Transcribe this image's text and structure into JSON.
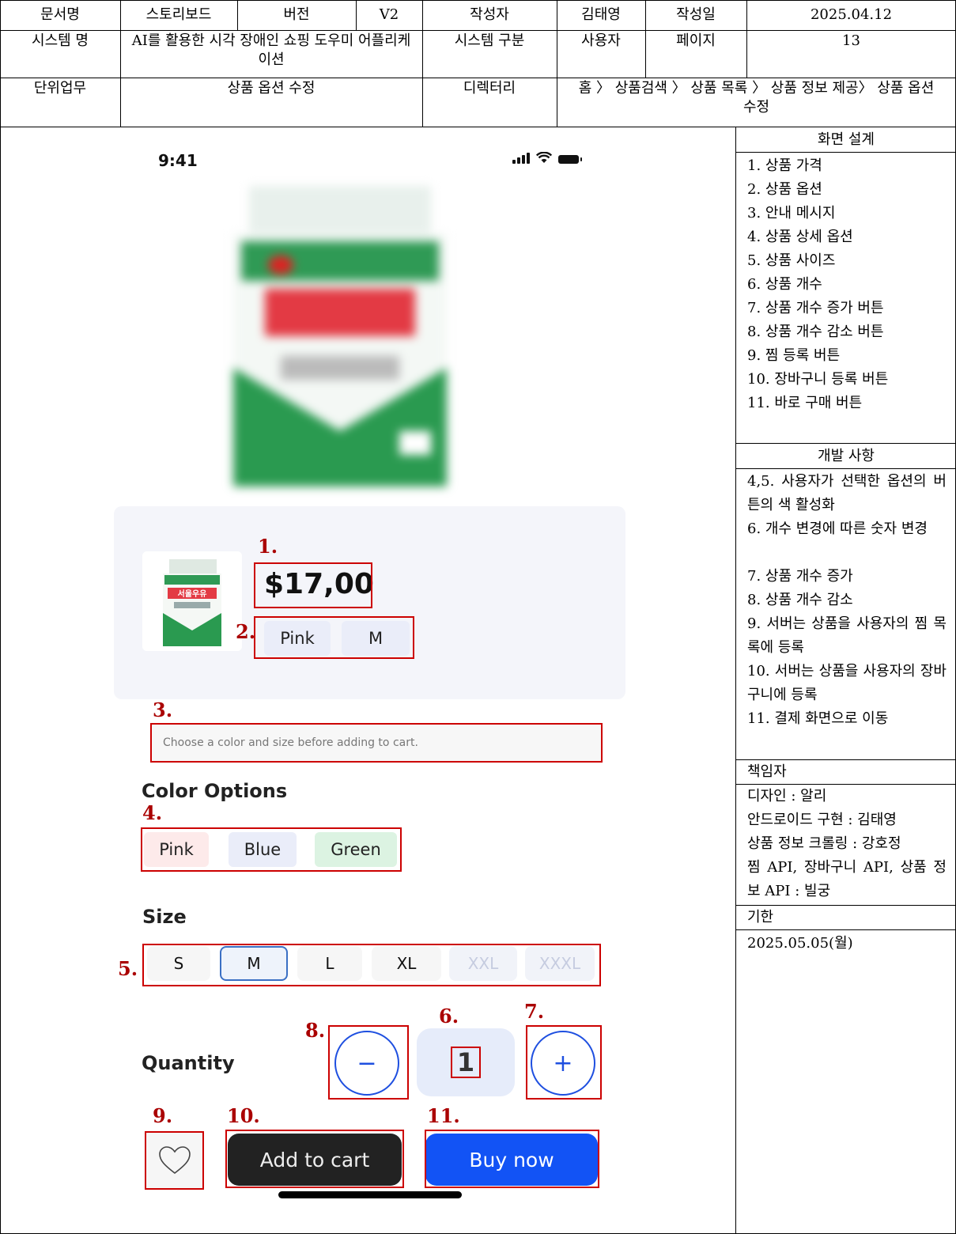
{
  "header": {
    "doc_name_label": "문서명",
    "doc_name_value": "스토리보드",
    "version_label": "버전",
    "version_value": "V2",
    "author_label": "작성자",
    "author_value": "김태영",
    "date_label": "작성일",
    "date_value": "2025.04.12",
    "system_name_label": "시스템 명",
    "system_name_value": "AI를 활용한 시각 장애인 쇼핑 도우미 어플리케이션",
    "system_type_label": "시스템 구분",
    "system_type_value": "사용자",
    "page_label": "페이지",
    "page_value": "13",
    "task_label": "단위업무",
    "task_value": "상품 옵션 수정",
    "directory_label": "디렉터리",
    "directory_value": "홈 〉 상품검색 〉 상품 목록 〉 상품 정보 제공〉 상품 옵션 수정"
  },
  "phone": {
    "status_time": "9:41",
    "price": "$17,00",
    "selected_chips": [
      "Pink",
      "M"
    ],
    "hint_text": "Choose a color and size before adding to cart.",
    "color_title": "Color Options",
    "colors": [
      "Pink",
      "Blue",
      "Green"
    ],
    "size_title": "Size",
    "sizes": [
      "S",
      "M",
      "L",
      "XL",
      "XXL",
      "XXXL"
    ],
    "quantity_title": "Quantity",
    "quantity_value": "1",
    "minus_symbol": "−",
    "plus_symbol": "+",
    "add_to_cart": "Add to cart",
    "buy_now": "Buy now",
    "colors_hex": {
      "pink_bg": "#fdeaea",
      "blue_bg": "#eaedf9",
      "green_bg": "#dcf3e2",
      "buy": "#1253f5",
      "cart": "#222222"
    }
  },
  "annotations": [
    "1.",
    "2.",
    "3.",
    "4.",
    "5.",
    "6.",
    "7.",
    "8.",
    "9.",
    "10.",
    "11."
  ],
  "panel": {
    "design_title": "화면 설계",
    "design_items": [
      "1. 상품 가격",
      "2. 상품 옵션",
      "3. 안내 메시지",
      "4. 상품 상세 옵션",
      "5. 상품 사이즈",
      "6. 상품 개수",
      "7. 상품 개수 증가 버튼",
      "8. 상품 개수 감소 버튼",
      "9. 찜 등록 버튼",
      "10. 장바구니 등록 버튼",
      "11. 바로 구매 버튼"
    ],
    "dev_title": "개발 사항",
    "dev_items": [
      "4,5. 사용자가 선택한 옵션의 버튼의 색 활성화",
      "6. 개수 변경에 따른 숫자 변경",
      "7. 상품 개수 증가",
      "8. 상품 개수 감소",
      "9. 서버는 상품을 사용자의 찜 목록에 등록",
      "10. 서버는 상품을 사용자의 장바구니에 등록",
      "11. 결제 화면으로 이동"
    ],
    "owner_title": "책임자",
    "owner_items": [
      "디자인 : 알리",
      "안드로이드 구현 : 김태영",
      "상품 정보 크롤링 : 강호정",
      "찜 API, 장바구니 API, 상품 정보 API : 빌궁"
    ],
    "deadline_title": "기한",
    "deadline_value": "2025.05.05(월)"
  }
}
